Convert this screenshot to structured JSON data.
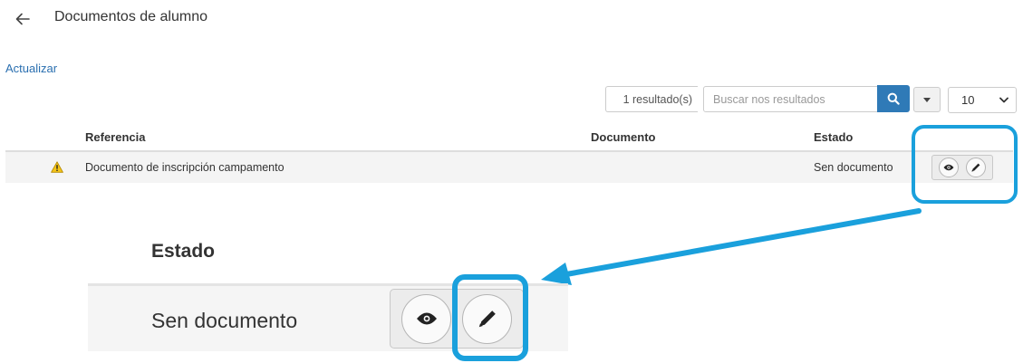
{
  "header": {
    "back_icon": "arrow-left-icon",
    "title": "Documentos de alumno"
  },
  "actions": {
    "refresh_label": "Actualizar"
  },
  "toolbar": {
    "result_count": "1 resultado(s)",
    "search_placeholder": "Buscar nos resultados",
    "search_icon": "search-icon",
    "dropdown_icon": "caret-down-icon",
    "page_size": "10"
  },
  "table": {
    "columns": [
      "Referencia",
      "Documento",
      "Estado"
    ],
    "rows": [
      {
        "status_icon": "warning-icon",
        "reference": "Documento de inscripción campamento",
        "document": "",
        "state": "Sen documento",
        "actions": [
          "eye-icon",
          "pencil-icon"
        ]
      }
    ]
  },
  "zoom": {
    "heading": "Estado",
    "status": "Sen documento"
  },
  "colors": {
    "highlight": "#1aa0dc",
    "link": "#2a6fb0",
    "primary_button": "#2f7ab7",
    "warning": "#f5c518"
  }
}
